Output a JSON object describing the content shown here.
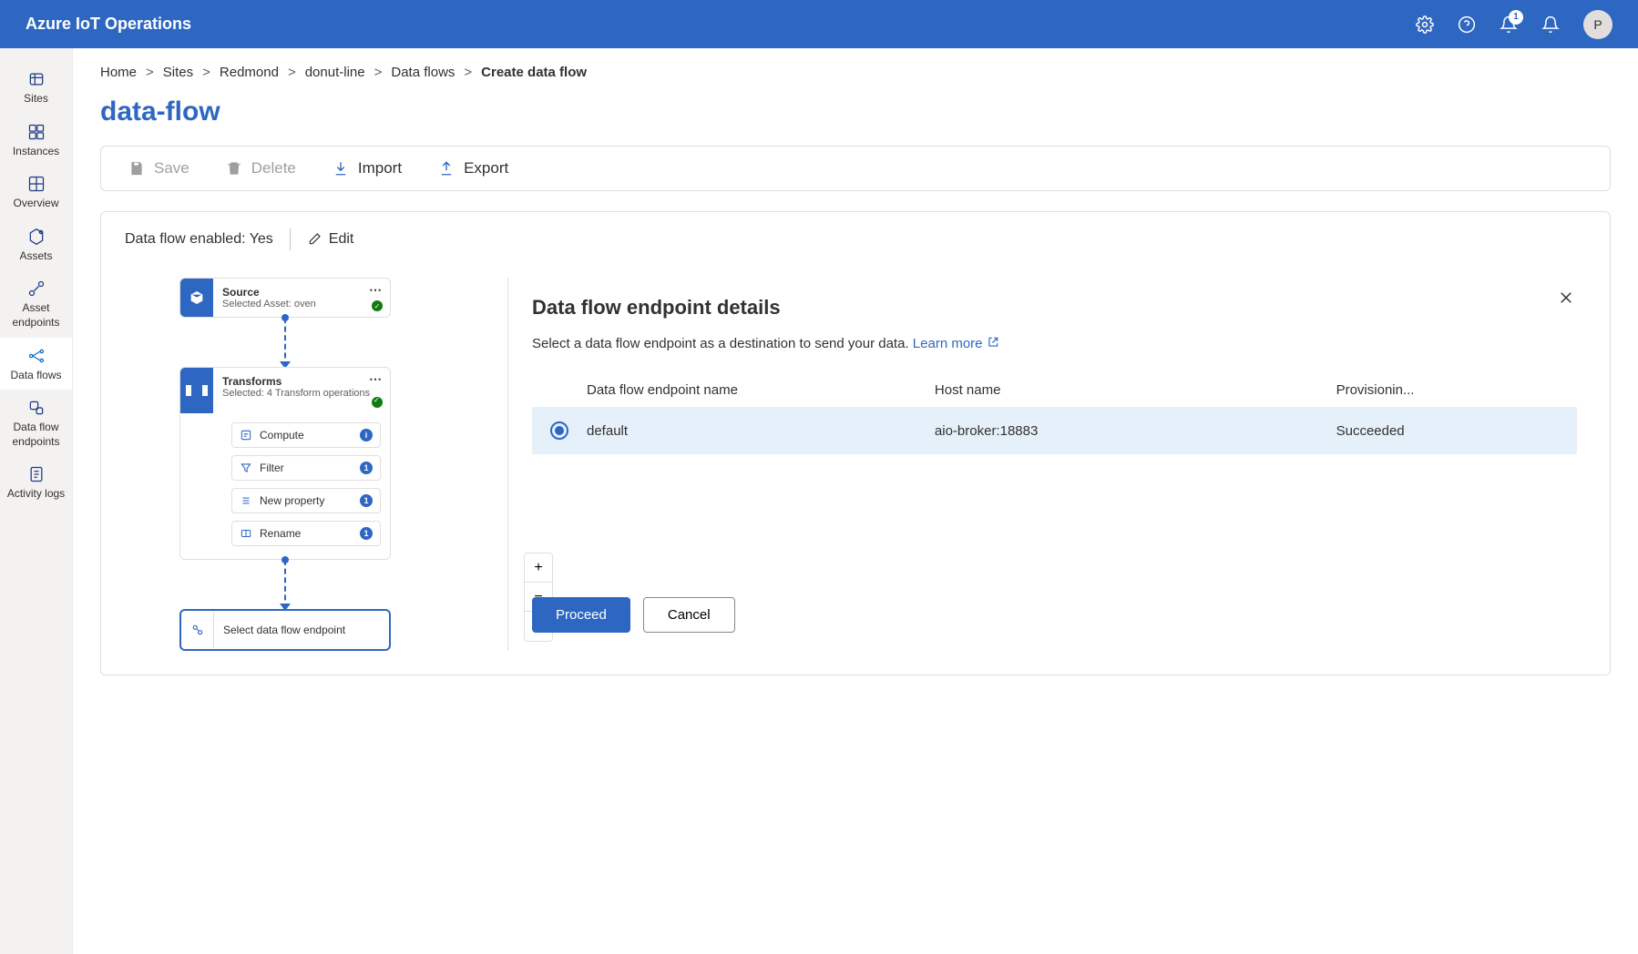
{
  "header": {
    "title": "Azure IoT Operations",
    "notification_count": "1",
    "avatar_initial": "P"
  },
  "sidebar": {
    "items": [
      {
        "label": "Sites"
      },
      {
        "label": "Instances"
      },
      {
        "label": "Overview"
      },
      {
        "label": "Assets"
      },
      {
        "label": "Asset endpoints"
      },
      {
        "label": "Data flows"
      },
      {
        "label": "Data flow endpoints"
      },
      {
        "label": "Activity logs"
      }
    ]
  },
  "breadcrumb": {
    "items": [
      "Home",
      "Sites",
      "Redmond",
      "donut-line",
      "Data flows",
      "Create data flow"
    ]
  },
  "page_title": "data-flow",
  "toolbar": {
    "save": "Save",
    "delete": "Delete",
    "import": "Import",
    "export": "Export"
  },
  "flow": {
    "enabled_label": "Data flow enabled: Yes",
    "edit_label": "Edit",
    "source": {
      "title": "Source",
      "subtitle": "Selected Asset: oven"
    },
    "transforms": {
      "title": "Transforms",
      "subtitle": "Selected: 4 Transform operations",
      "ops": [
        {
          "label": "Compute",
          "badge": "i"
        },
        {
          "label": "Filter",
          "badge": "1"
        },
        {
          "label": "New property",
          "badge": "1"
        },
        {
          "label": "Rename",
          "badge": "1"
        }
      ]
    },
    "destination_label": "Select data flow endpoint"
  },
  "panel": {
    "title": "Data flow endpoint details",
    "description": "Select a data flow endpoint as a destination to send your data.",
    "learn_more": "Learn more",
    "columns": {
      "name": "Data flow endpoint name",
      "host": "Host name",
      "state": "Provisionin..."
    },
    "rows": [
      {
        "name": "default",
        "host": "aio-broker:18883",
        "state": "Succeeded"
      }
    ],
    "proceed": "Proceed",
    "cancel": "Cancel"
  }
}
